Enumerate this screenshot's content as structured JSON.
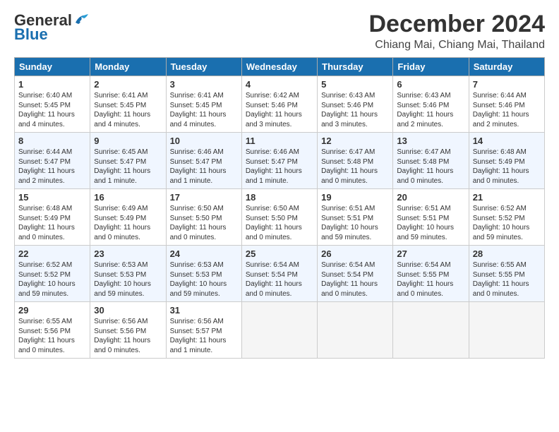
{
  "logo": {
    "line1": "General",
    "line2": "Blue"
  },
  "title": "December 2024",
  "location": "Chiang Mai, Chiang Mai, Thailand",
  "headers": [
    "Sunday",
    "Monday",
    "Tuesday",
    "Wednesday",
    "Thursday",
    "Friday",
    "Saturday"
  ],
  "weeks": [
    [
      {
        "day": "1",
        "info": "Sunrise: 6:40 AM\nSunset: 5:45 PM\nDaylight: 11 hours\nand 4 minutes."
      },
      {
        "day": "2",
        "info": "Sunrise: 6:41 AM\nSunset: 5:45 PM\nDaylight: 11 hours\nand 4 minutes."
      },
      {
        "day": "3",
        "info": "Sunrise: 6:41 AM\nSunset: 5:45 PM\nDaylight: 11 hours\nand 4 minutes."
      },
      {
        "day": "4",
        "info": "Sunrise: 6:42 AM\nSunset: 5:46 PM\nDaylight: 11 hours\nand 3 minutes."
      },
      {
        "day": "5",
        "info": "Sunrise: 6:43 AM\nSunset: 5:46 PM\nDaylight: 11 hours\nand 3 minutes."
      },
      {
        "day": "6",
        "info": "Sunrise: 6:43 AM\nSunset: 5:46 PM\nDaylight: 11 hours\nand 2 minutes."
      },
      {
        "day": "7",
        "info": "Sunrise: 6:44 AM\nSunset: 5:46 PM\nDaylight: 11 hours\nand 2 minutes."
      }
    ],
    [
      {
        "day": "8",
        "info": "Sunrise: 6:44 AM\nSunset: 5:47 PM\nDaylight: 11 hours\nand 2 minutes."
      },
      {
        "day": "9",
        "info": "Sunrise: 6:45 AM\nSunset: 5:47 PM\nDaylight: 11 hours\nand 1 minute."
      },
      {
        "day": "10",
        "info": "Sunrise: 6:46 AM\nSunset: 5:47 PM\nDaylight: 11 hours\nand 1 minute."
      },
      {
        "day": "11",
        "info": "Sunrise: 6:46 AM\nSunset: 5:47 PM\nDaylight: 11 hours\nand 1 minute."
      },
      {
        "day": "12",
        "info": "Sunrise: 6:47 AM\nSunset: 5:48 PM\nDaylight: 11 hours\nand 0 minutes."
      },
      {
        "day": "13",
        "info": "Sunrise: 6:47 AM\nSunset: 5:48 PM\nDaylight: 11 hours\nand 0 minutes."
      },
      {
        "day": "14",
        "info": "Sunrise: 6:48 AM\nSunset: 5:49 PM\nDaylight: 11 hours\nand 0 minutes."
      }
    ],
    [
      {
        "day": "15",
        "info": "Sunrise: 6:48 AM\nSunset: 5:49 PM\nDaylight: 11 hours\nand 0 minutes."
      },
      {
        "day": "16",
        "info": "Sunrise: 6:49 AM\nSunset: 5:49 PM\nDaylight: 11 hours\nand 0 minutes."
      },
      {
        "day": "17",
        "info": "Sunrise: 6:50 AM\nSunset: 5:50 PM\nDaylight: 11 hours\nand 0 minutes."
      },
      {
        "day": "18",
        "info": "Sunrise: 6:50 AM\nSunset: 5:50 PM\nDaylight: 11 hours\nand 0 minutes."
      },
      {
        "day": "19",
        "info": "Sunrise: 6:51 AM\nSunset: 5:51 PM\nDaylight: 10 hours\nand 59 minutes."
      },
      {
        "day": "20",
        "info": "Sunrise: 6:51 AM\nSunset: 5:51 PM\nDaylight: 10 hours\nand 59 minutes."
      },
      {
        "day": "21",
        "info": "Sunrise: 6:52 AM\nSunset: 5:52 PM\nDaylight: 10 hours\nand 59 minutes."
      }
    ],
    [
      {
        "day": "22",
        "info": "Sunrise: 6:52 AM\nSunset: 5:52 PM\nDaylight: 10 hours\nand 59 minutes."
      },
      {
        "day": "23",
        "info": "Sunrise: 6:53 AM\nSunset: 5:53 PM\nDaylight: 10 hours\nand 59 minutes."
      },
      {
        "day": "24",
        "info": "Sunrise: 6:53 AM\nSunset: 5:53 PM\nDaylight: 10 hours\nand 59 minutes."
      },
      {
        "day": "25",
        "info": "Sunrise: 6:54 AM\nSunset: 5:54 PM\nDaylight: 11 hours\nand 0 minutes."
      },
      {
        "day": "26",
        "info": "Sunrise: 6:54 AM\nSunset: 5:54 PM\nDaylight: 11 hours\nand 0 minutes."
      },
      {
        "day": "27",
        "info": "Sunrise: 6:54 AM\nSunset: 5:55 PM\nDaylight: 11 hours\nand 0 minutes."
      },
      {
        "day": "28",
        "info": "Sunrise: 6:55 AM\nSunset: 5:55 PM\nDaylight: 11 hours\nand 0 minutes."
      }
    ],
    [
      {
        "day": "29",
        "info": "Sunrise: 6:55 AM\nSunset: 5:56 PM\nDaylight: 11 hours\nand 0 minutes."
      },
      {
        "day": "30",
        "info": "Sunrise: 6:56 AM\nSunset: 5:56 PM\nDaylight: 11 hours\nand 0 minutes."
      },
      {
        "day": "31",
        "info": "Sunrise: 6:56 AM\nSunset: 5:57 PM\nDaylight: 11 hours\nand 1 minute."
      },
      {
        "day": "",
        "info": ""
      },
      {
        "day": "",
        "info": ""
      },
      {
        "day": "",
        "info": ""
      },
      {
        "day": "",
        "info": ""
      }
    ]
  ]
}
